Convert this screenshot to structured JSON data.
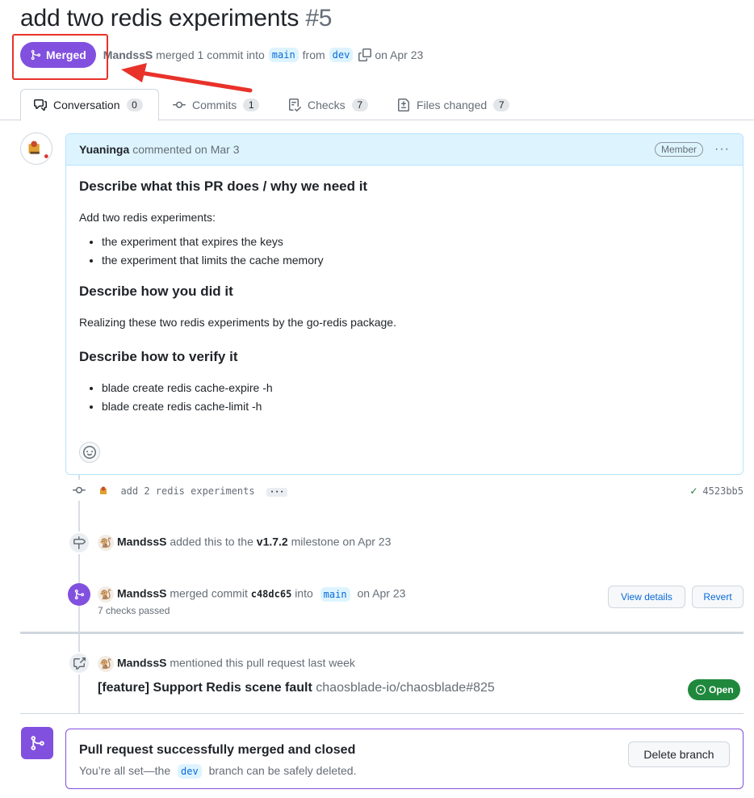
{
  "pr": {
    "title": "add two redis experiments",
    "number": "#5",
    "state": "Merged",
    "author": "MandssS",
    "merge_text": "merged 1 commit into",
    "base_branch": "main",
    "from_text": "from",
    "head_branch": "dev",
    "date_text": "on Apr 23"
  },
  "tabs": [
    {
      "label": "Conversation",
      "count": "0"
    },
    {
      "label": "Commits",
      "count": "1"
    },
    {
      "label": "Checks",
      "count": "7"
    },
    {
      "label": "Files changed",
      "count": "7"
    }
  ],
  "comment": {
    "author": "Yuaninga",
    "meta": "commented on Mar 3",
    "role": "Member",
    "menu": "···",
    "h1": "Describe what this PR does / why we need it",
    "p1": "Add two redis experiments:",
    "list1": [
      "the experiment that expires the keys",
      "the experiment that limits the cache memory"
    ],
    "h2": "Describe how you did it",
    "p2": "Realizing these two redis experiments by the go-redis package.",
    "h3": "Describe how to verify it",
    "list2": [
      "blade create redis cache-expire -h",
      "blade create redis cache-limit -h"
    ]
  },
  "timeline": {
    "commit": {
      "message": "add 2 redis experiments",
      "ellipsis": "···",
      "sha": "4523bb5"
    },
    "milestone": {
      "actor": "MandssS",
      "text": "added this to the",
      "milestone": "v1.7.2",
      "suffix": "milestone on Apr 23"
    },
    "merged": {
      "actor": "MandssS",
      "text": "merged commit",
      "commit": "c48dc65",
      "into": "into",
      "branch": "main",
      "date": "on Apr 23",
      "checks": "7 checks passed",
      "view_details": "View details",
      "revert": "Revert"
    },
    "mention": {
      "actor": "MandssS",
      "text": "mentioned this pull request last week",
      "ref_title": "[feature] Support Redis scene fault",
      "ref_repo": "chaosblade-io/chaosblade#825",
      "ref_state": "Open"
    }
  },
  "merge_box": {
    "title": "Pull request successfully merged and closed",
    "text_before": "You’re all set—the",
    "branch": "dev",
    "text_after": "branch can be safely deleted.",
    "delete_button": "Delete branch"
  },
  "colors": {
    "merged_purple": "#8250df",
    "open_green": "#1f883d",
    "link_blue": "#0969da",
    "annotation_red": "#e8322a"
  }
}
